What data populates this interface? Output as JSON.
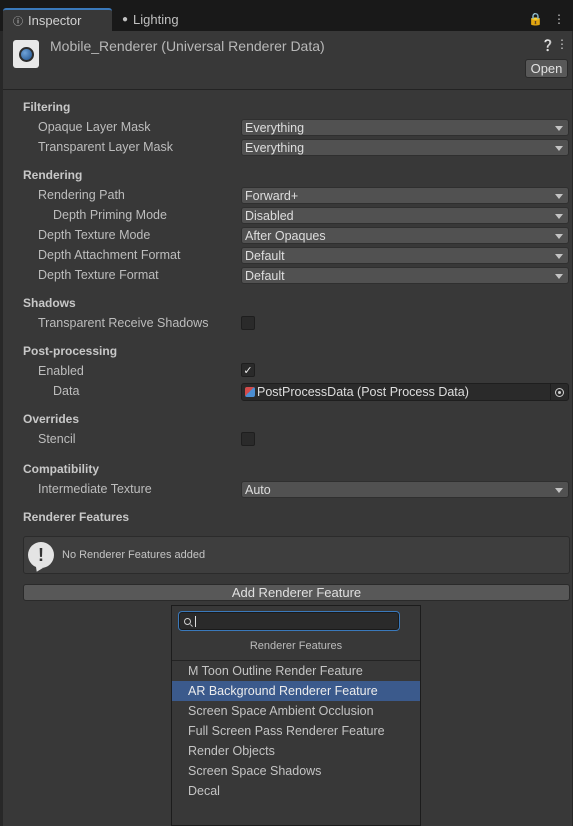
{
  "tabs": [
    {
      "label": "Inspector",
      "icon": "info-icon",
      "active": true
    },
    {
      "label": "Lighting",
      "icon": "lightbulb-icon",
      "active": false
    }
  ],
  "header": {
    "title": "Mobile_Renderer (Universal Renderer Data)",
    "open_label": "Open"
  },
  "sections": {
    "filtering": "Filtering",
    "rendering": "Rendering",
    "shadows": "Shadows",
    "post_processing": "Post-processing",
    "overrides": "Overrides",
    "compatibility": "Compatibility",
    "renderer_features": "Renderer Features"
  },
  "fields": {
    "opaque_layer_mask": {
      "label": "Opaque Layer Mask",
      "value": "Everything"
    },
    "transparent_layer_mask": {
      "label": "Transparent Layer Mask",
      "value": "Everything"
    },
    "rendering_path": {
      "label": "Rendering Path",
      "value": "Forward+"
    },
    "depth_priming_mode": {
      "label": "Depth Priming Mode",
      "value": "Disabled"
    },
    "depth_texture_mode": {
      "label": "Depth Texture Mode",
      "value": "After Opaques"
    },
    "depth_attachment_format": {
      "label": "Depth Attachment Format",
      "value": "Default"
    },
    "depth_texture_format": {
      "label": "Depth Texture Format",
      "value": "Default"
    },
    "transparent_receive_shadows": {
      "label": "Transparent Receive Shadows",
      "checked": false
    },
    "enabled": {
      "label": "Enabled",
      "checked": true
    },
    "data": {
      "label": "Data",
      "value": "PostProcessData (Post Process Data)"
    },
    "stencil": {
      "label": "Stencil",
      "checked": false
    },
    "intermediate_texture": {
      "label": "Intermediate Texture",
      "value": "Auto"
    }
  },
  "helpbox": {
    "text": "No Renderer Features added"
  },
  "add_button": {
    "label": "Add Renderer Feature"
  },
  "popup": {
    "search_value": "",
    "header": "Renderer Features",
    "items": [
      "M Toon Outline Render Feature",
      "AR Background Renderer Feature",
      "Screen Space Ambient Occlusion",
      "Full Screen Pass Renderer Feature",
      "Render Objects",
      "Screen Space Shadows",
      "Decal"
    ],
    "selected_item": "AR Background Renderer Feature"
  },
  "colors": {
    "accent": "#3a79bb",
    "selection": "#3b5a8c",
    "panel": "#383838",
    "tabbar": "#191919"
  }
}
